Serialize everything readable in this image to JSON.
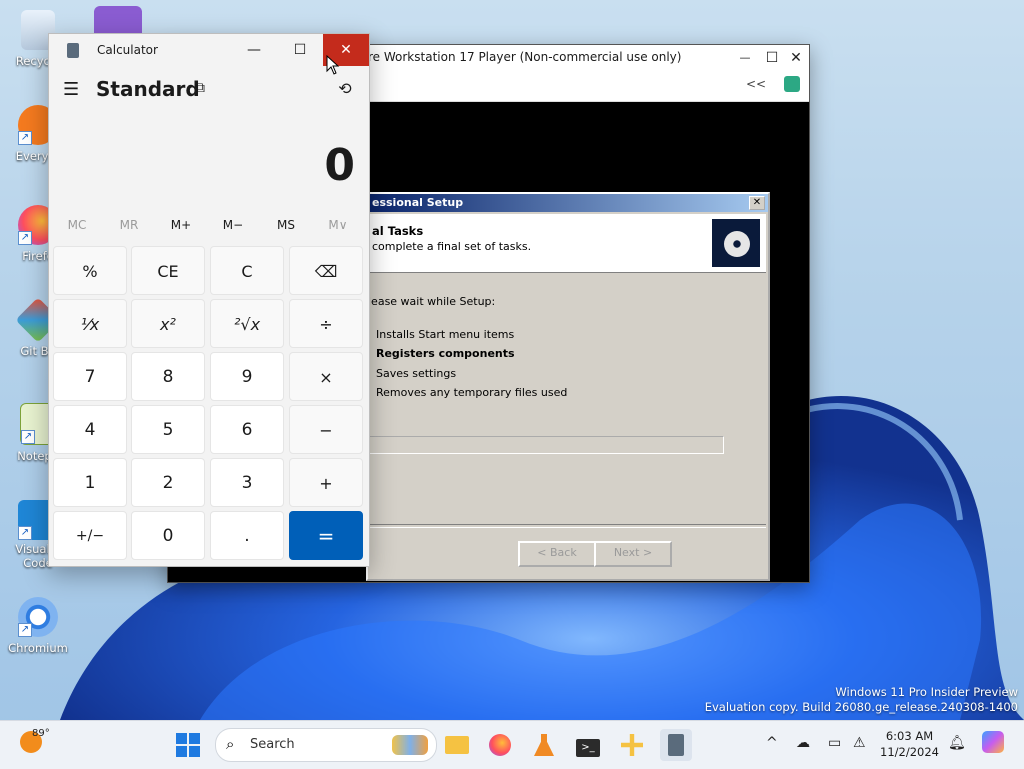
{
  "desktop": {
    "icons": [
      {
        "label": "Recycle"
      },
      {
        "label": "Everyth"
      },
      {
        "label": "Firefo"
      },
      {
        "label": "Git Ba"
      },
      {
        "label": "Notepa"
      },
      {
        "label": "Visual S",
        "label2": "Code"
      },
      {
        "label": "Chromium"
      }
    ]
  },
  "vmware": {
    "title": "re Workstation 17 Player (Non-commercial use only)",
    "minimize": "—",
    "maximize": "☐",
    "close": "✕",
    "toolbar_collapse": "<<"
  },
  "setup": {
    "title": "essional Setup",
    "close": "✕",
    "heading": "al Tasks",
    "subheading": "complete a final set of tasks.",
    "wait_text": "lease wait while Setup:",
    "tasks": [
      {
        "label": "Installs Start menu items",
        "bold": false
      },
      {
        "label": "Registers components",
        "bold": true
      },
      {
        "label": "Saves settings",
        "bold": false
      },
      {
        "label": "Removes any temporary files used",
        "bold": false
      }
    ],
    "back_label": "< Back",
    "next_label": "Next >"
  },
  "calculator": {
    "app_name": "Calculator",
    "mode": "Standard",
    "display": "0",
    "memory": [
      {
        "label": "MC",
        "enabled": false
      },
      {
        "label": "MR",
        "enabled": false
      },
      {
        "label": "M+",
        "enabled": true
      },
      {
        "label": "M−",
        "enabled": true
      },
      {
        "label": "MS",
        "enabled": true
      },
      {
        "label": "M∨",
        "enabled": false
      }
    ],
    "keys": [
      [
        "%",
        "CE",
        "C",
        "⌫"
      ],
      [
        "¹⁄x",
        "x²",
        "²√x",
        "÷"
      ],
      [
        "7",
        "8",
        "9",
        "×"
      ],
      [
        "4",
        "5",
        "6",
        "−"
      ],
      [
        "1",
        "2",
        "3",
        "+"
      ],
      [
        "+/−",
        "0",
        ".",
        "="
      ]
    ]
  },
  "watermark": {
    "line1": "Windows 11 Pro Insider Preview",
    "line2": "Evaluation copy. Build 26080.ge_release.240308-1400"
  },
  "taskbar": {
    "weather_temp": "89°",
    "search_placeholder": "Search",
    "clock_time": "6:03 AM",
    "clock_date": "11/2/2024"
  }
}
